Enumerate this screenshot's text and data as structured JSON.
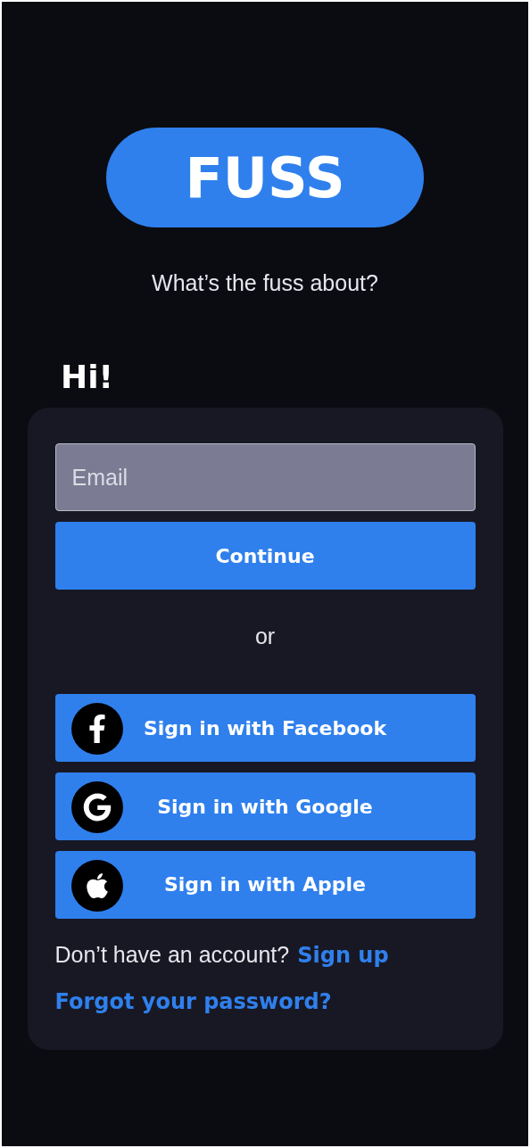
{
  "logo": {
    "text": "FUSS"
  },
  "tagline": "What’s the fuss about?",
  "greeting": "Hi!",
  "email": {
    "placeholder": "Email"
  },
  "continue_button": "Continue",
  "divider_text": "or",
  "social_buttons": [
    {
      "kind": "facebook",
      "label": "Sign in with Facebook"
    },
    {
      "kind": "google",
      "label": "Sign in with Google"
    },
    {
      "kind": "apple",
      "label": "Sign in with Apple"
    }
  ],
  "signup_prompt": {
    "text": "Don’t have an account?",
    "link": "Sign up"
  },
  "forgot_link": "Forgot your password?"
}
